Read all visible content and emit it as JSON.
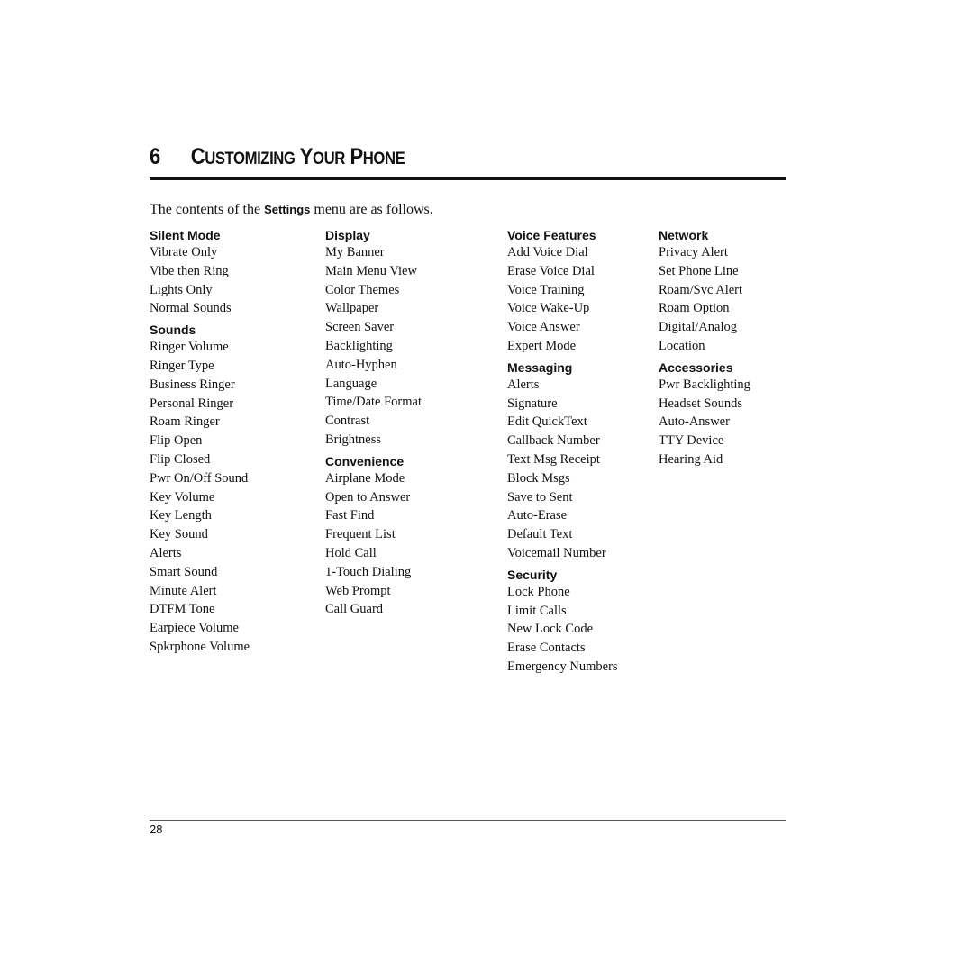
{
  "chapter": {
    "number": "6",
    "title_parts": [
      {
        "cap": "C",
        "rest": "USTOMIZING"
      },
      {
        "cap": "Y",
        "rest": "OUR"
      },
      {
        "cap": "P",
        "rest": "HONE"
      }
    ]
  },
  "intro": {
    "before": "The contents of the ",
    "keyword": "Settings",
    "after": " menu are as follows."
  },
  "columns": [
    {
      "sections": [
        {
          "heading": "Silent Mode",
          "items": [
            "Vibrate Only",
            "Vibe then Ring",
            "Lights Only",
            "Normal Sounds"
          ]
        },
        {
          "heading": "Sounds",
          "items": [
            "Ringer Volume",
            "Ringer Type",
            "Business Ringer",
            "Personal Ringer",
            "Roam Ringer",
            "Flip Open",
            "Flip Closed",
            "Pwr On/Off Sound",
            "Key Volume",
            "Key Length",
            "Key Sound",
            "Alerts",
            "Smart Sound",
            "Minute Alert",
            "DTFM Tone",
            "Earpiece Volume",
            "Spkrphone Volume"
          ]
        }
      ]
    },
    {
      "sections": [
        {
          "heading": "Display",
          "items": [
            "My Banner",
            "Main Menu View",
            "Color Themes",
            "Wallpaper",
            "Screen Saver",
            "Backlighting",
            "Auto-Hyphen",
            "Language",
            "Time/Date Format",
            "Contrast",
            "Brightness"
          ]
        },
        {
          "heading": "Convenience",
          "items": [
            "Airplane Mode",
            "Open to Answer",
            "Fast Find",
            "Frequent List",
            "Hold Call",
            "1-Touch Dialing",
            "Web Prompt",
            "Call Guard"
          ]
        }
      ]
    },
    {
      "sections": [
        {
          "heading": "Voice Features",
          "items": [
            "Add Voice Dial",
            "Erase Voice Dial",
            "Voice Training",
            "Voice Wake-Up",
            "Voice Answer",
            "Expert Mode"
          ]
        },
        {
          "heading": "Messaging",
          "items": [
            "Alerts",
            "Signature",
            "Edit QuickText",
            "Callback Number",
            "Text Msg Receipt",
            "Block Msgs",
            "Save to Sent",
            "Auto-Erase",
            "Default Text",
            "Voicemail Number"
          ]
        },
        {
          "heading": "Security",
          "items": [
            "Lock Phone",
            "Limit Calls",
            "New Lock Code",
            "Erase Contacts",
            "Emergency Numbers"
          ]
        }
      ]
    },
    {
      "sections": [
        {
          "heading": "Network",
          "items": [
            "Privacy Alert",
            "Set Phone Line",
            "Roam/Svc Alert",
            "Roam Option",
            "Digital/Analog",
            "Location"
          ]
        },
        {
          "heading": "Accessories",
          "items": [
            "Pwr Backlighting",
            "Headset Sounds",
            "Auto-Answer",
            "TTY Device",
            "Hearing Aid"
          ]
        }
      ]
    }
  ],
  "footer": {
    "page_number": "28"
  }
}
